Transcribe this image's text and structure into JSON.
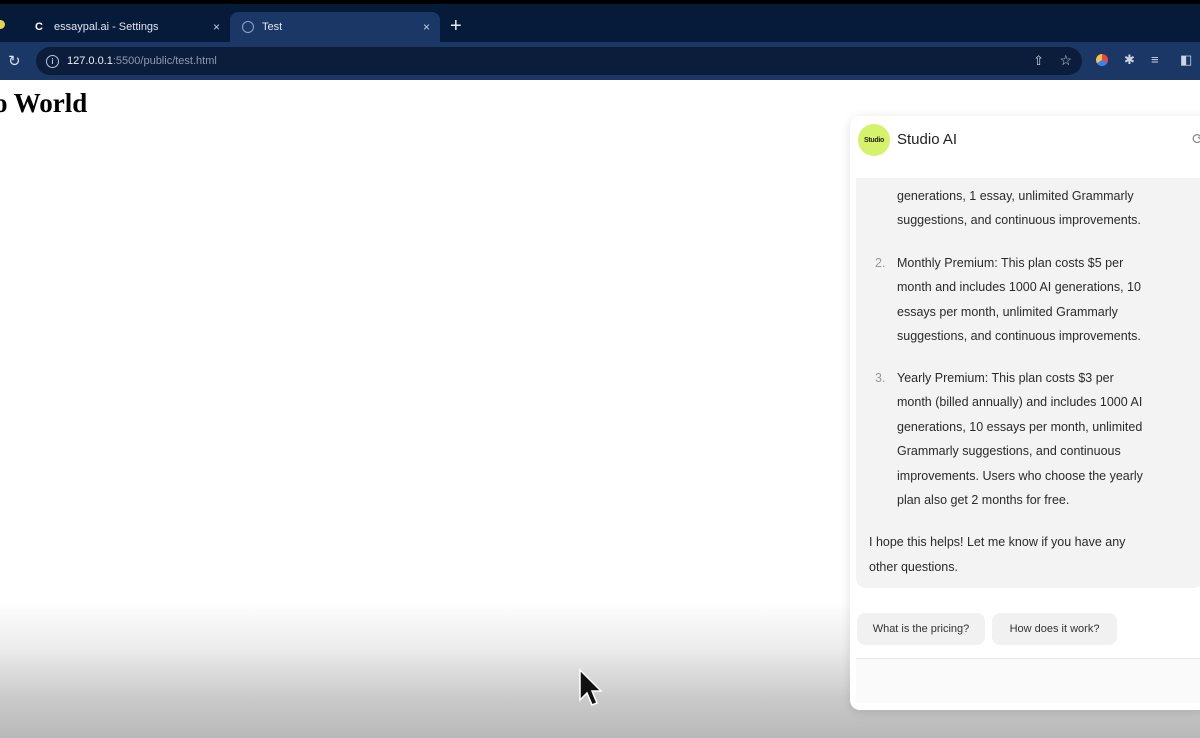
{
  "browser": {
    "tabs": [
      {
        "favicon": "C",
        "title": "essaypal.ai - Settings",
        "close": "×"
      },
      {
        "favicon": "globe",
        "title": "Test",
        "close": "×"
      }
    ],
    "new_tab": "+",
    "url_host": "127.0.0.1",
    "url_rest": ":5500/public/test.html"
  },
  "page": {
    "heading": "o World"
  },
  "chat": {
    "logo_text": "Studio",
    "title": "Studio AI",
    "lines": [
      "generations, 1 essay, unlimited Grammarly",
      "suggestions, and continuous improvements.",
      "Monthly Premium: This plan costs $5 per",
      "month and includes 1000 AI generations, 10",
      "essays per month, unlimited Grammarly",
      "suggestions, and continuous improvements.",
      "Yearly Premium: This plan costs $3 per",
      "month (billed annually) and includes 1000 AI",
      "generations, 10 essays per month, unlimited",
      "Grammarly suggestions, and continuous",
      "improvements. Users who choose the yearly",
      "plan also get 2 months for free.",
      "I hope this helps! Let me know if you have any",
      "other questions."
    ],
    "numbers": [
      "2.",
      "3."
    ],
    "suggestions": [
      "What is the pricing?",
      "How does it work?"
    ]
  },
  "colors": {
    "accent_logo": "#d6f26a",
    "chrome_dark": "#061a3a",
    "chrome_toolbar": "#1b3765"
  }
}
